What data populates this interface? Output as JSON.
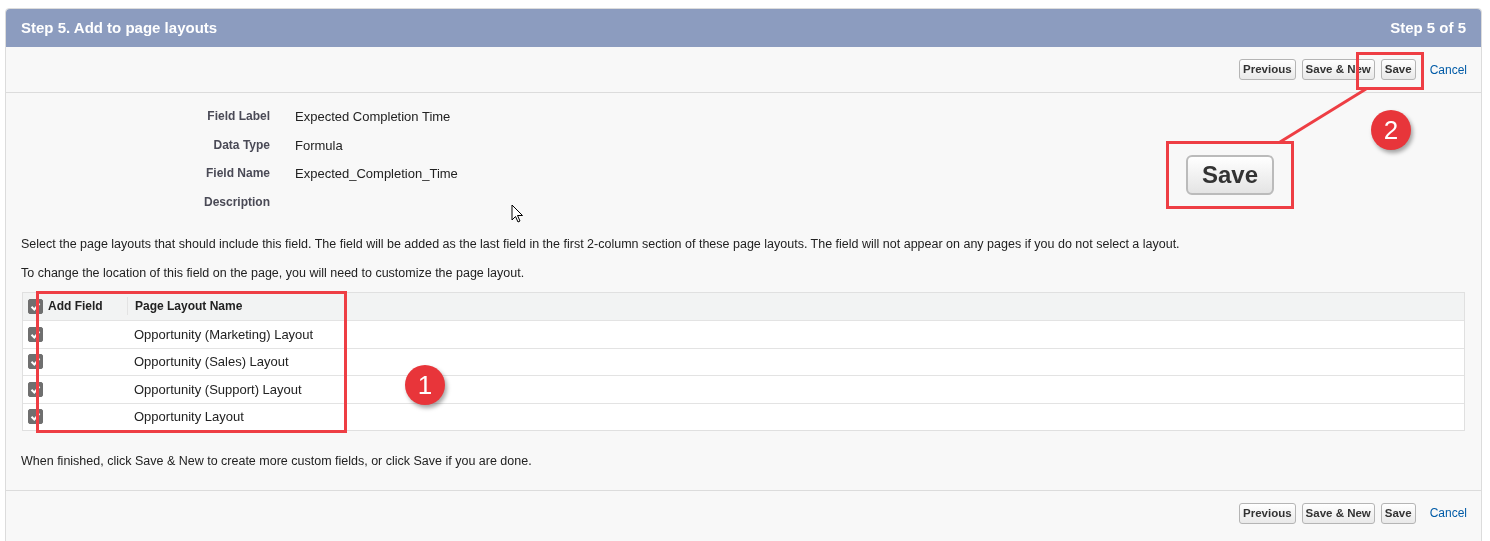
{
  "header": {
    "title": "Step 5. Add to page layouts",
    "step": "Step 5 of 5"
  },
  "top_buttons": [
    {
      "kind": "button",
      "label": "Previous"
    },
    {
      "kind": "button",
      "label": "Save & New"
    },
    {
      "kind": "button",
      "label": "Save"
    },
    {
      "kind": "link",
      "label": "Cancel"
    }
  ],
  "fields": [
    {
      "label": "Field Label",
      "value": "Expected Completion Time"
    },
    {
      "label": "Data Type",
      "value": "Formula"
    },
    {
      "label": "Field Name",
      "value": "Expected_Completion_Time"
    },
    {
      "label": "Description"
    }
  ],
  "instructions": [
    "Select the page layouts that should include this field. The field will be added as the last field in the first 2-column section of these page layouts. The field will not appear on any pages if you do not select a layout.",
    "To change the location of this field on the page, you will need to customize the page layout."
  ],
  "table": {
    "select_all_checked": true,
    "columns": [
      "Add Field",
      "Page Layout Name"
    ],
    "rows": [
      {
        "checked": true,
        "name": "Opportunity (Marketing) Layout"
      },
      {
        "checked": true,
        "name": "Opportunity (Sales) Layout"
      },
      {
        "checked": true,
        "name": "Opportunity (Support) Layout"
      },
      {
        "checked": true,
        "name": "Opportunity Layout"
      }
    ]
  },
  "footer_note": "When finished, click Save & New to create more custom fields, or click Save if you are done.",
  "bottom_buttons": [
    {
      "kind": "button",
      "label": "Previous"
    },
    {
      "kind": "button",
      "label": "Save & New"
    },
    {
      "kind": "button",
      "label": "Save"
    },
    {
      "kind": "link",
      "label": "Cancel"
    }
  ],
  "annotations": {
    "callouts": [
      "1",
      "2"
    ],
    "zoomed_button": "Save"
  }
}
